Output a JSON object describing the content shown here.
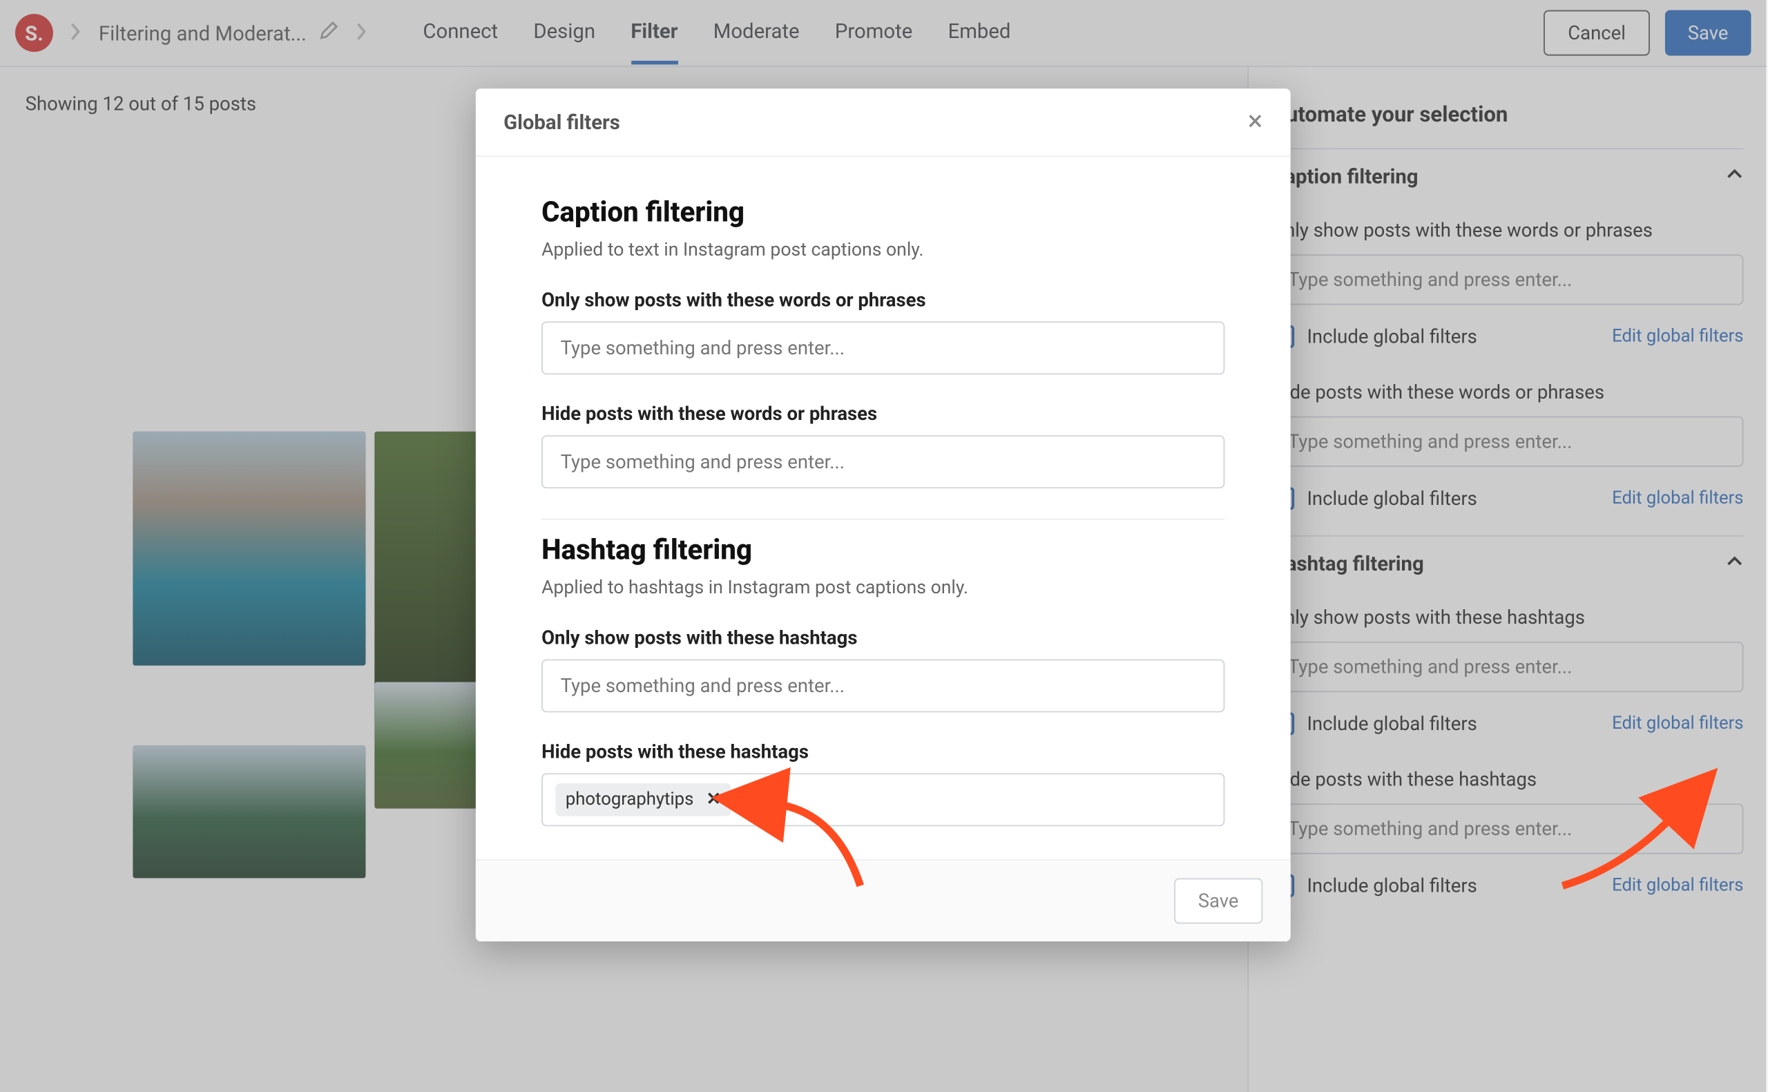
{
  "topbar": {
    "logo_letter": "S.",
    "breadcrumb_title": "Filtering and Moderat...",
    "nav": [
      {
        "label": "Connect",
        "active": false
      },
      {
        "label": "Design",
        "active": false
      },
      {
        "label": "Filter",
        "active": true
      },
      {
        "label": "Moderate",
        "active": false
      },
      {
        "label": "Promote",
        "active": false
      },
      {
        "label": "Embed",
        "active": false
      }
    ],
    "actions": {
      "cancel": "Cancel",
      "save": "Save"
    }
  },
  "main": {
    "result_count": "Showing 12 out of 15 posts"
  },
  "sidepanel": {
    "title": "Automate your selection",
    "caption": {
      "header": "Caption filtering",
      "only_label": "Only show posts with these words or phrases",
      "hide_label": "Hide posts with these words or phrases",
      "placeholder": "Type something and press enter...",
      "include_label": "Include global filters",
      "edit_link": "Edit global filters"
    },
    "hashtag": {
      "header": "Hashtag filtering",
      "only_label": "Only show posts with these hashtags",
      "hide_label": "Hide posts with these hashtags",
      "placeholder": "Type something and press enter...",
      "include_label": "Include global filters",
      "edit_link": "Edit global filters"
    }
  },
  "modal": {
    "title": "Global filters",
    "caption": {
      "header": "Caption filtering",
      "desc": "Applied to text in Instagram post captions only.",
      "only_label": "Only show posts with these words or phrases",
      "hide_label": "Hide posts with these words or phrases",
      "placeholder": "Type something and press enter..."
    },
    "hashtag": {
      "header": "Hashtag filtering",
      "desc": "Applied to hashtags in Instagram post captions only.",
      "only_label": "Only show posts with these hashtags",
      "hide_label": "Hide posts with these hashtags",
      "placeholder": "Type something and press enter...",
      "tags": [
        "photographytips"
      ]
    },
    "footer": {
      "save": "Save"
    }
  }
}
